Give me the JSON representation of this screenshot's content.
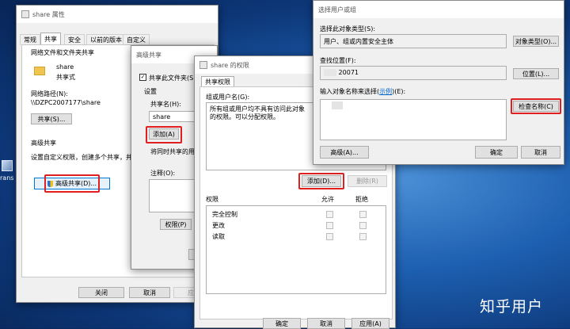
{
  "desktop": {
    "icon_label": "rans",
    "watermark": "知乎用户"
  },
  "props": {
    "title": "share 属性",
    "tabs": [
      "常规",
      "共享",
      "安全",
      "以前的版本",
      "自定义"
    ],
    "section_share": "网络文件和文件夹共享",
    "share_name": "share",
    "share_type": "共享式",
    "path_label": "网络路径(N):",
    "path_value": "\\\\DZPC2007177\\share",
    "share_btn": "共享(S)...",
    "adv_section": "高级共享",
    "adv_desc": "设置自定义权限，创建多个共享，并设",
    "adv_btn": "高级共享(D)...",
    "close": "关闭",
    "cancel": "取消",
    "apply": "应用"
  },
  "adv": {
    "title": "高级共享",
    "share_checkbox": "共享此文件夹(S)",
    "settings": "设置",
    "share_name_label": "共享名(H):",
    "share_name_value": "share",
    "add": "添加(A)",
    "limit": "将同时共享的用户",
    "comment": "注释(O):",
    "perm_btn": "权限(P)"
  },
  "perm": {
    "title": "share 的权限",
    "tab": "共享权限",
    "group_label": "组或用户名(G):",
    "group_text": "所有组或用户均不具有访问此对象的权限。可以分配权限。",
    "add": "添加(D)...",
    "remove": "删除(R)",
    "perm_label": "权限",
    "allow": "允许",
    "deny": "拒绝",
    "rows": [
      "完全控制",
      "更改",
      "读取"
    ],
    "ok": "确定",
    "cancel": "取消",
    "apply": "应用(A)"
  },
  "select": {
    "title": "选择用户或组",
    "type_label": "选择此对象类型(S):",
    "type_value": "用户、组或内置安全主体",
    "type_btn": "对象类型(O)...",
    "loc_label": "查找位置(F):",
    "loc_value": "20071",
    "loc_btn": "位置(L)...",
    "enter_label_a": "输入对象名称来选择(",
    "enter_link": "示例",
    "enter_label_b": ")(E):",
    "check_btn": "检查名称(C)",
    "adv_btn": "高级(A)...",
    "ok": "确定",
    "cancel": "取消"
  }
}
